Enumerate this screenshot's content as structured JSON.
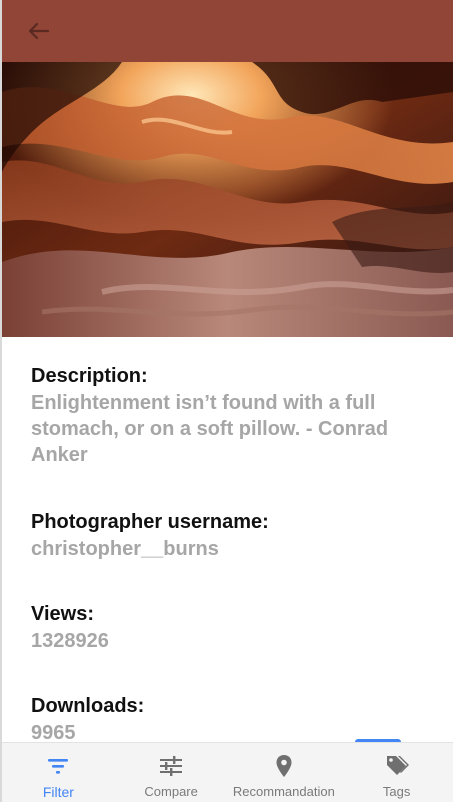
{
  "appbar": {
    "back_icon": "arrow-left-icon",
    "color": "#914537"
  },
  "hero": {
    "alt": "canyon-photo"
  },
  "details": {
    "description_label": "Description:",
    "description_value": "Enlightenment isn’t found with a full stomach, or on a soft pillow. - Conrad Anker",
    "username_label": "Photographer username:",
    "username_value": "christopher__burns",
    "views_label": "Views:",
    "views_value": "1328926",
    "downloads_label": "Downloads:",
    "downloads_value": "9965"
  },
  "bottom_nav": {
    "items": [
      {
        "label": "Filter",
        "icon": "filter-icon",
        "active": true
      },
      {
        "label": "Compare",
        "icon": "sliders-icon",
        "active": false
      },
      {
        "label": "Recommandation",
        "icon": "location-pin-icon",
        "active": false
      },
      {
        "label": "Tags",
        "icon": "tags-icon",
        "active": false
      }
    ],
    "active_color": "#4285f4"
  }
}
